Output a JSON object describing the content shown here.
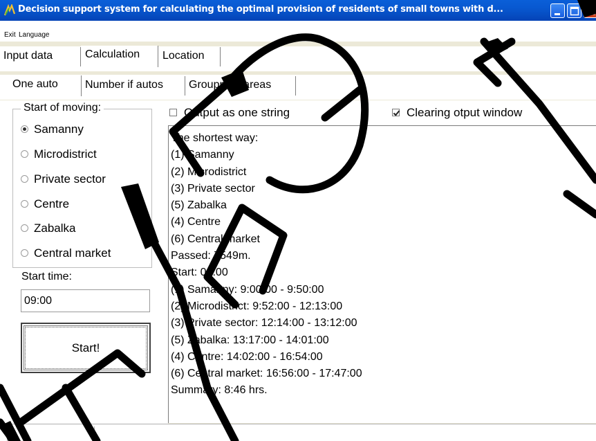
{
  "window": {
    "title": "Decision support system for calculating the optimal provision of residents of small towns with d...",
    "minimize_icon": "minimize-icon",
    "maximize_icon": "maximize-icon",
    "close_icon": "close-icon"
  },
  "menu": {
    "exit": "Exit",
    "language": "Language"
  },
  "main_tabs": [
    {
      "label": "Input data",
      "active": false
    },
    {
      "label": "Calculation",
      "active": true
    },
    {
      "label": "Location",
      "active": false
    }
  ],
  "sub_tabs": [
    {
      "label": "One auto",
      "active": true
    },
    {
      "label": "Number if autos",
      "active": false
    },
    {
      "label": "Groupping areas",
      "active": false
    }
  ],
  "start_of_moving": {
    "title": "Start of moving:",
    "options": [
      {
        "label": "Samanny",
        "selected": true
      },
      {
        "label": "Microdistrict",
        "selected": false
      },
      {
        "label": "Private sector",
        "selected": false
      },
      {
        "label": "Centre",
        "selected": false
      },
      {
        "label": "Zabalka",
        "selected": false
      },
      {
        "label": "Central market",
        "selected": false
      }
    ]
  },
  "start_time": {
    "label": "Start time:",
    "value": "09:00"
  },
  "start_button": "Start!",
  "options": {
    "output_as_one_string": {
      "label": "Output as one string",
      "checked": false
    },
    "clearing_output_window": {
      "label": "Clearing otput window",
      "checked": true
    }
  },
  "output_lines": [
    "The shortest way:",
    "(1) Samanny",
    "(2) Microdistrict",
    "(3) Private sector",
    "(5) Zabalka",
    "(4) Centre",
    "(6) Central market",
    "Passed: 7549m.",
    "Start: 09:00",
    "(1) Samanny: 9:00:00 - 9:50:00",
    "(2) Microdistrict: 9:52:00 - 12:13:00",
    "(3) Private sector: 12:14:00 - 13:12:00",
    "(5) Zabalka: 13:17:00 - 14:01:00",
    "(4) Centre: 14:02:00 - 16:54:00",
    "(6) Central market: 16:56:00 - 17:47:00",
    "Summary: 8:46 hrs."
  ],
  "colors": {
    "titlebar": "#0858d0",
    "watermark": "#000000"
  }
}
